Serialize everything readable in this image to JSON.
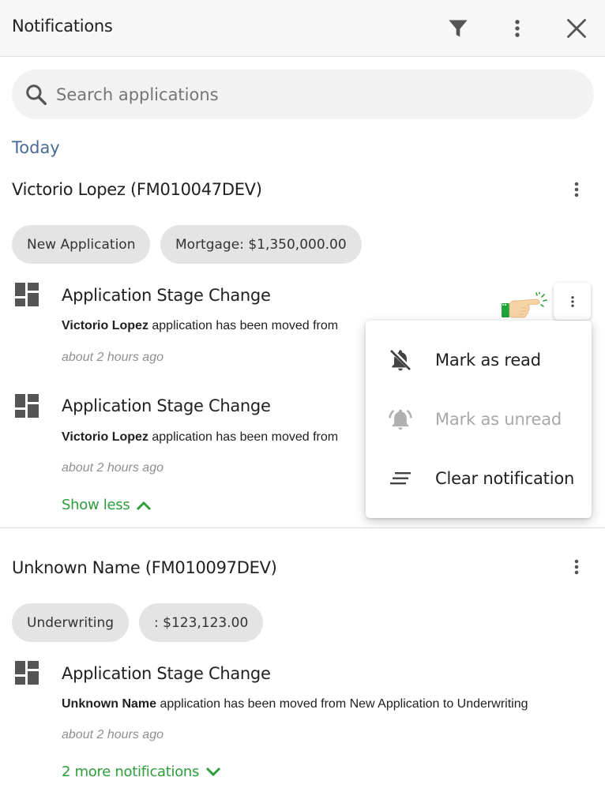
{
  "header": {
    "title": "Notifications",
    "filter_icon": "filter-icon",
    "more_icon": "more-vert-icon",
    "close_icon": "close-icon"
  },
  "search": {
    "placeholder": "Search applications",
    "value": ""
  },
  "section": {
    "label": "Today"
  },
  "groups": [
    {
      "title": "Victorio Lopez (FM010047DEV)",
      "chips": [
        "New Application",
        "Mortgage: $1,350,000.00"
      ],
      "notifications": [
        {
          "title": "Application Stage Change",
          "body_name": "Victorio Lopez",
          "body_text": " application has been moved from",
          "time": "about 2 hours ago"
        },
        {
          "title": "Application Stage Change",
          "body_name": "Victorio Lopez",
          "body_text": " application has been moved from",
          "time": "about 2 hours ago"
        }
      ],
      "toggle_label": "Show less"
    },
    {
      "title": "Unknown Name (FM010097DEV)",
      "chips": [
        "Underwriting",
        ": $123,123.00"
      ],
      "notifications": [
        {
          "title": "Application Stage Change",
          "body_name": "Unknown Name",
          "body_text": " application has been moved from New Application to Underwriting",
          "time": "about 2 hours ago"
        }
      ],
      "toggle_label": "2 more notifications"
    }
  ],
  "context_menu": {
    "items": [
      {
        "label": "Mark as read",
        "icon": "bell-off-icon",
        "enabled": true
      },
      {
        "label": "Mark as unread",
        "icon": "bell-ring-icon",
        "enabled": false
      },
      {
        "label": "Clear notification",
        "icon": "clear-all-icon",
        "enabled": true
      }
    ]
  },
  "colors": {
    "accent_link": "#2e9e3a",
    "section_label": "#4a6a94",
    "chip_bg": "#e4e4e4"
  }
}
